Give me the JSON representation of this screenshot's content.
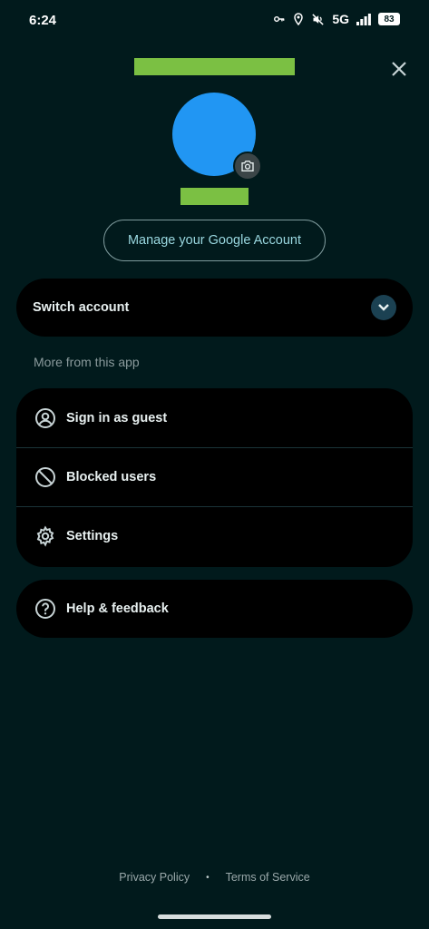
{
  "status_bar": {
    "time": "6:24",
    "network": "5G",
    "battery": "83",
    "icons": [
      "key-icon",
      "location-icon",
      "mute-icon",
      "signal-icon",
      "battery-icon"
    ]
  },
  "account": {
    "manage_label": "Manage your Google Account",
    "avatar_color": "#2196f3"
  },
  "switch_account": {
    "label": "Switch account"
  },
  "section": {
    "heading": "More from this app"
  },
  "menu": {
    "items": [
      {
        "label": "Sign in as guest",
        "icon": "account-circle-icon"
      },
      {
        "label": "Blocked users",
        "icon": "block-icon"
      },
      {
        "label": "Settings",
        "icon": "gear-icon"
      }
    ],
    "help": {
      "label": "Help & feedback",
      "icon": "help-icon"
    }
  },
  "footer": {
    "privacy": "Privacy Policy",
    "separator": "•",
    "terms": "Terms of Service"
  },
  "colors": {
    "background": "#011a1c",
    "card": "#000000",
    "accent_text": "#9ad8e0",
    "redacted": "#7bc043"
  }
}
